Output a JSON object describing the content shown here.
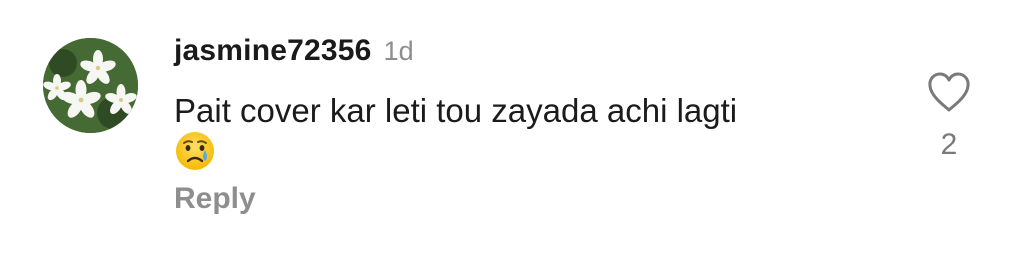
{
  "comment": {
    "username": "jasmine72356",
    "time": "1d",
    "text": "Pait cover kar leti tou zayada achi lagti",
    "emoji": "crying-face",
    "reply_label": "Reply",
    "likes": "2",
    "like_icon": "heart-outline-icon"
  },
  "colors": {
    "username": "#1a1a1a",
    "meta_gray": "#8e8e8e",
    "text": "#1b1b1b",
    "background": "#ffffff"
  }
}
